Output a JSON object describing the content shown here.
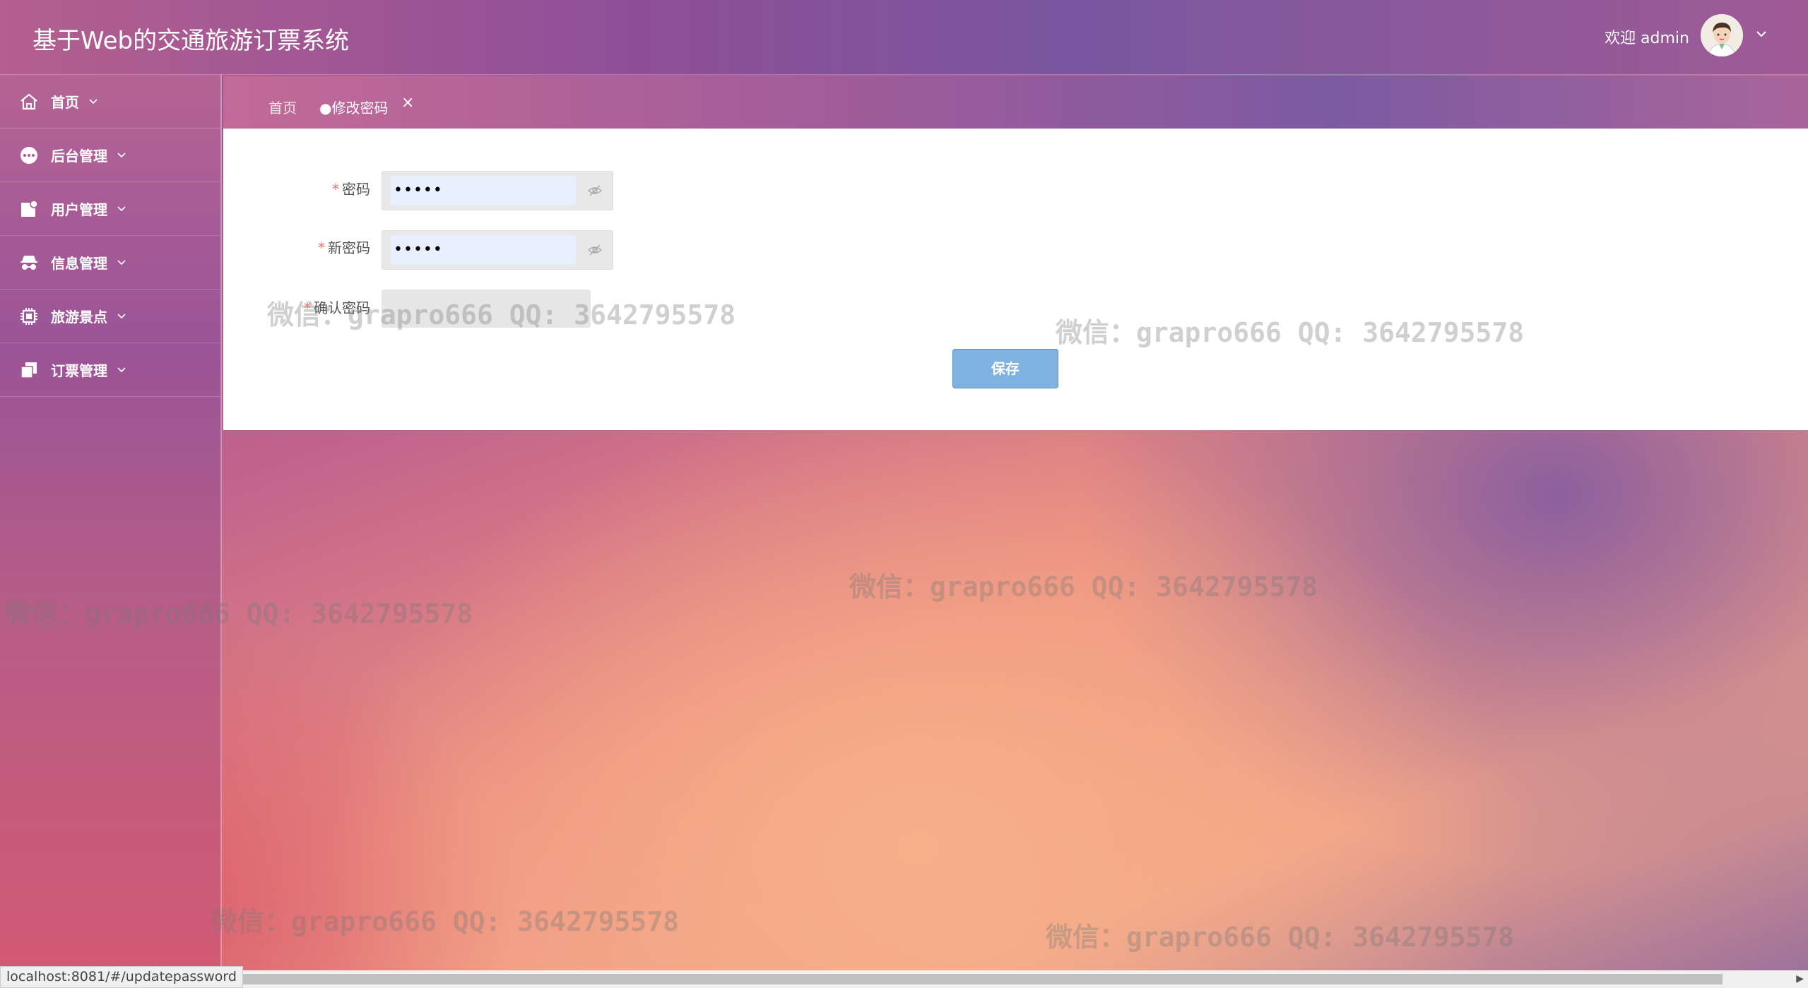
{
  "header": {
    "title": "基于Web的交通旅游订票系统",
    "welcome": "欢迎 admin"
  },
  "sidebar": {
    "items": [
      {
        "label": "首页",
        "icon": "home-icon"
      },
      {
        "label": "后台管理",
        "icon": "more-circle-icon"
      },
      {
        "label": "用户管理",
        "icon": "user-card-icon"
      },
      {
        "label": "信息管理",
        "icon": "incognito-icon"
      },
      {
        "label": "旅游景点",
        "icon": "cpu-chip-icon"
      },
      {
        "label": "订票管理",
        "icon": "copy-icon"
      }
    ]
  },
  "tabs": {
    "home": "首页",
    "active": "●修改密码",
    "close": "×"
  },
  "form": {
    "password_label": "密码",
    "password_value": "•••••",
    "new_password_label": "新密码",
    "new_password_value": "•••••",
    "confirm_label": "确认密码",
    "required_mark": "*",
    "save_label": "保存"
  },
  "watermark": "微信：grapro666 QQ: 3642795578",
  "statusbar": {
    "url": "localhost:8081/#/updatepassword"
  },
  "colors": {
    "save_button": "#7fb2e0",
    "required": "#f56c6c",
    "input_autofill": "#e8f0fe"
  }
}
